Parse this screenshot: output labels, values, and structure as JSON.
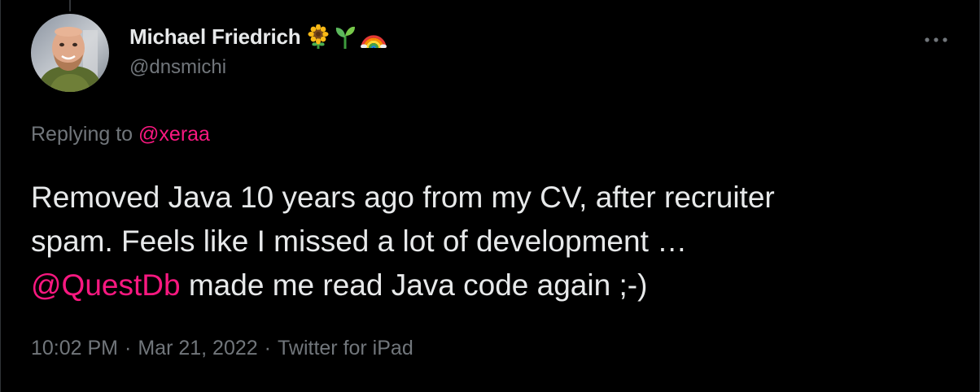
{
  "author": {
    "display_name": "Michael Friedrich",
    "handle": "@dnsmichi",
    "emoji_icons": [
      "sunflower-icon",
      "seedling-icon",
      "rainbow-icon"
    ]
  },
  "reply": {
    "prefix": "Replying to",
    "mention": "@xeraa"
  },
  "tweet": {
    "line1": "Removed Java 10 years ago from my CV, after recruiter",
    "line2": "spam. Feels like I missed a lot of development …",
    "line3_mention": "@QuestDb",
    "line3_rest": " made me read Java code again ;-)"
  },
  "meta": {
    "time": "10:02 PM",
    "date": "Mar 21, 2022",
    "source": "Twitter for iPad",
    "separator": "·"
  },
  "colors": {
    "background": "#000000",
    "text": "#e7e9ea",
    "secondary": "#71767b",
    "mention": "#f91880"
  }
}
